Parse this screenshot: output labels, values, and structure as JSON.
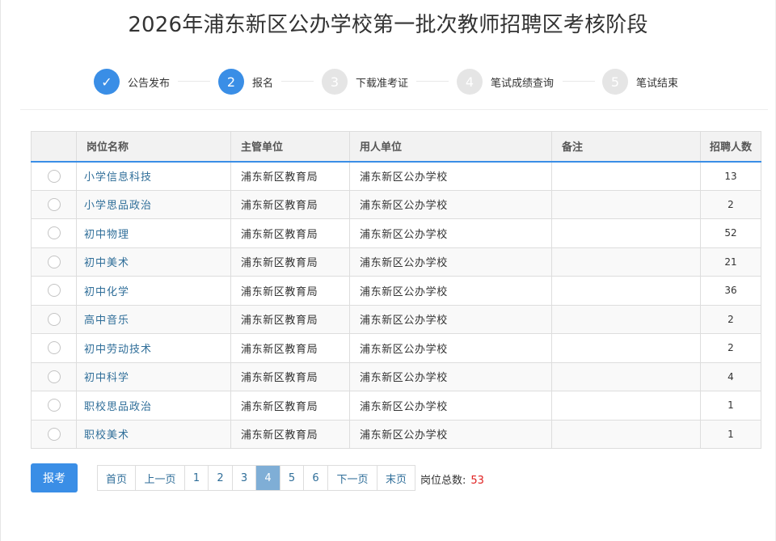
{
  "page": {
    "title": "2026年浦东新区公办学校第一批次教师招聘区考核阶段"
  },
  "steps": [
    {
      "number": "✓",
      "label": "公告发布",
      "state": "done"
    },
    {
      "number": "2",
      "label": "报名",
      "state": "active"
    },
    {
      "number": "3",
      "label": "下载准考证",
      "state": "pending"
    },
    {
      "number": "4",
      "label": "笔试成绩查询",
      "state": "pending"
    },
    {
      "number": "5",
      "label": "笔试结束",
      "state": "pending"
    }
  ],
  "table": {
    "headers": {
      "name": "岗位名称",
      "dept": "主管单位",
      "employer": "用人单位",
      "remark": "备注",
      "count": "招聘人数"
    },
    "rows": [
      {
        "name": "小学信息科技",
        "dept": "浦东新区教育局",
        "employer": "浦东新区公办学校",
        "remark": "",
        "count": "13"
      },
      {
        "name": "小学思品政治",
        "dept": "浦东新区教育局",
        "employer": "浦东新区公办学校",
        "remark": "",
        "count": "2"
      },
      {
        "name": "初中物理",
        "dept": "浦东新区教育局",
        "employer": "浦东新区公办学校",
        "remark": "",
        "count": "52"
      },
      {
        "name": "初中美术",
        "dept": "浦东新区教育局",
        "employer": "浦东新区公办学校",
        "remark": "",
        "count": "21"
      },
      {
        "name": "初中化学",
        "dept": "浦东新区教育局",
        "employer": "浦东新区公办学校",
        "remark": "",
        "count": "36"
      },
      {
        "name": "高中音乐",
        "dept": "浦东新区教育局",
        "employer": "浦东新区公办学校",
        "remark": "",
        "count": "2"
      },
      {
        "name": "初中劳动技术",
        "dept": "浦东新区教育局",
        "employer": "浦东新区公办学校",
        "remark": "",
        "count": "2"
      },
      {
        "name": "初中科学",
        "dept": "浦东新区教育局",
        "employer": "浦东新区公办学校",
        "remark": "",
        "count": "4"
      },
      {
        "name": "职校思品政治",
        "dept": "浦东新区教育局",
        "employer": "浦东新区公办学校",
        "remark": "",
        "count": "1"
      },
      {
        "name": "职校美术",
        "dept": "浦东新区教育局",
        "employer": "浦东新区公办学校",
        "remark": "",
        "count": "1"
      }
    ]
  },
  "actions": {
    "apply_label": "报考"
  },
  "pagination": {
    "first": "首页",
    "prev": "上一页",
    "pages": [
      "1",
      "2",
      "3",
      "4",
      "5",
      "6"
    ],
    "current": "4",
    "next": "下一页",
    "last": "末页"
  },
  "summary": {
    "total_label": "岗位总数:",
    "total_value": "53"
  },
  "colors": {
    "accent": "#3a8ee6",
    "link": "#2f6e99",
    "current_page": "#7faed6",
    "total_value": "#e02020"
  }
}
